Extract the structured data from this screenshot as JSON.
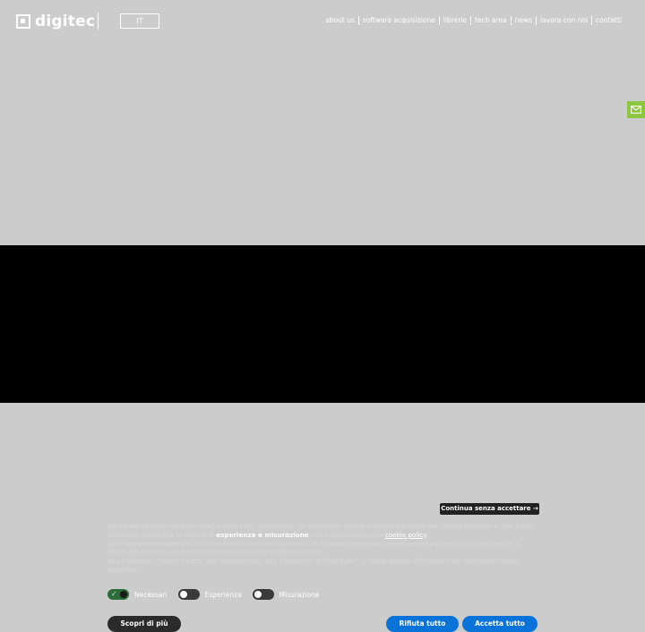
{
  "header": {
    "logo_text": "digitec",
    "language": "IT",
    "nav": [
      "about us",
      "software acquisizione",
      "librerie",
      "tech area",
      "news",
      "lavora con noi",
      "contatti"
    ]
  },
  "contact_tab": {
    "icon": "mail-icon"
  },
  "cookie_banner": {
    "continue_label": "Continua senza accettare →",
    "text_1a": "Noi (www.digitecinnovation.com) e terze parti selezionate (4) utilizziamo cookie o tecnologie simili per finalità tecniche e, con il tuo consenso, anche per le finalità di ",
    "text_1b": "esperienza e misurazione",
    "text_1c": " come specificato nella ",
    "cookie_policy_link": "cookie policy",
    "text_1d": ".",
    "text_2": "Puoi liberamente prestare, rifiutare o revocare il tuo consenso, in qualsiasi momento, accedendo al pannello delle preferenze. Il rifiuto del consenso può rendere non disponibili le relative funzioni.",
    "text_3": "Usa il pulsante “Accetta tutto” per acconsentire. Usa il pulsante “Rifiuta tutto” o chiudi questa informativa per continuare senza accettare.",
    "toggles": [
      {
        "label": "Necessari",
        "on": true
      },
      {
        "label": "Esperienza",
        "on": false
      },
      {
        "label": "Misurazione",
        "on": false
      }
    ],
    "more_label": "Scopri di più",
    "reject_label": "Rifiuta tutto",
    "accept_label": "Accetta tutto"
  },
  "colors": {
    "page_bg": "#cccccc",
    "banner_bg": "#000000",
    "primary_button": "#0a73d9",
    "contact_tab": "#8dc63f",
    "toggle_on": "#2e6b3a"
  }
}
